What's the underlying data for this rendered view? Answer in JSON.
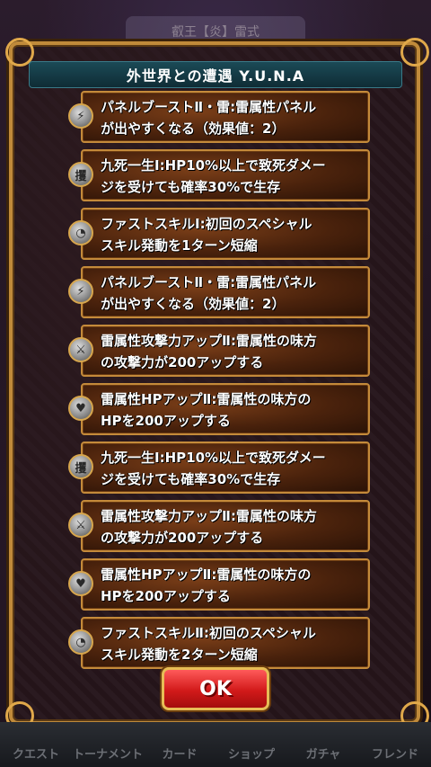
{
  "background": {
    "title": "叡王【炎】雷式",
    "tabs": [
      {
        "label": "クエスト"
      },
      {
        "label": "トーナメント"
      },
      {
        "label": "カード"
      },
      {
        "label": "ショップ"
      },
      {
        "label": "ガチャ"
      },
      {
        "label": "フレンド"
      }
    ]
  },
  "dialog": {
    "title": "外世界との遭遇 Y.U.N.A",
    "skills": [
      {
        "icon": "panel-boost-icon",
        "glyph": "⚡",
        "line1": "パネルブーストⅡ・雷:雷属性パネル",
        "line2": "が出やすくなる（効果値：2）"
      },
      {
        "icon": "survive-icon",
        "glyph": "攫",
        "line1": "九死一生Ⅰ:HP10%以上で致死ダメー",
        "line2": "ジを受けても確率30%で生存"
      },
      {
        "icon": "fast-skill-icon",
        "glyph": "◔",
        "line1": "ファストスキルⅠ:初回のスペシャル",
        "line2": "スキル発動を1ターン短縮"
      },
      {
        "icon": "panel-boost-icon",
        "glyph": "⚡",
        "line1": "パネルブーストⅡ・雷:雷属性パネル",
        "line2": "が出やすくなる（効果値：2）"
      },
      {
        "icon": "attack-up-icon",
        "glyph": "⚔",
        "line1": "雷属性攻撃力アップⅡ:雷属性の味方",
        "line2": "の攻撃力が200アップする"
      },
      {
        "icon": "hp-up-icon",
        "glyph": "♥",
        "line1": "雷属性HPアップⅡ:雷属性の味方の",
        "line2": "HPを200アップする"
      },
      {
        "icon": "survive-icon",
        "glyph": "攫",
        "line1": "九死一生Ⅰ:HP10%以上で致死ダメー",
        "line2": "ジを受けても確率30%で生存"
      },
      {
        "icon": "attack-up-icon",
        "glyph": "⚔",
        "line1": "雷属性攻撃力アップⅡ:雷属性の味方",
        "line2": "の攻撃力が200アップする"
      },
      {
        "icon": "hp-up-icon",
        "glyph": "♥",
        "line1": "雷属性HPアップⅡ:雷属性の味方の",
        "line2": "HPを200アップする"
      },
      {
        "icon": "fast-skill-icon",
        "glyph": "◔",
        "line1": "ファストスキルⅡ:初回のスペシャル",
        "line2": "スキル発動を2ターン短縮"
      }
    ],
    "ok_label": "OK"
  }
}
